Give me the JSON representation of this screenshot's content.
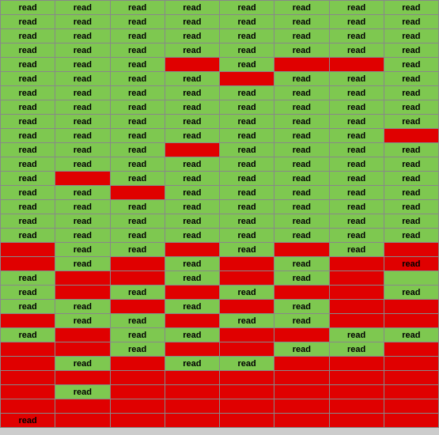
{
  "grid": {
    "rows": [
      [
        "green",
        "green",
        "green",
        "green",
        "green",
        "green",
        "green",
        "green"
      ],
      [
        "green",
        "green",
        "green",
        "green",
        "green",
        "green",
        "green",
        "green"
      ],
      [
        "green",
        "green",
        "green",
        "green",
        "green",
        "green",
        "green",
        "green"
      ],
      [
        "green",
        "green",
        "green",
        "green",
        "green",
        "green",
        "green",
        "green"
      ],
      [
        "green",
        "green",
        "green",
        "red",
        "green",
        "red",
        "red",
        "green"
      ],
      [
        "green",
        "green",
        "green",
        "green",
        "red",
        "green",
        "green",
        "green"
      ],
      [
        "green",
        "green",
        "green",
        "green",
        "green",
        "green",
        "green",
        "green"
      ],
      [
        "green",
        "green",
        "green",
        "green",
        "green",
        "green",
        "green",
        "green"
      ],
      [
        "green",
        "green",
        "green",
        "green",
        "green",
        "green",
        "green",
        "green"
      ],
      [
        "green",
        "green",
        "green",
        "green",
        "green",
        "green",
        "green",
        "red"
      ],
      [
        "green",
        "green",
        "green",
        "red",
        "green",
        "green",
        "green",
        "green"
      ],
      [
        "green",
        "green",
        "green",
        "green",
        "green",
        "green",
        "green",
        "green"
      ],
      [
        "green",
        "red",
        "green",
        "green",
        "green",
        "green",
        "green",
        "green"
      ],
      [
        "green",
        "green",
        "red",
        "green",
        "green",
        "green",
        "green",
        "green"
      ],
      [
        "green",
        "green",
        "green",
        "green",
        "green",
        "green",
        "green",
        "green"
      ],
      [
        "green",
        "green",
        "green",
        "green",
        "green",
        "green",
        "green",
        "green"
      ],
      [
        "green",
        "green",
        "green",
        "green",
        "green",
        "green",
        "green",
        "green"
      ],
      [
        "red",
        "green",
        "green",
        "red",
        "green",
        "red",
        "green",
        "red"
      ],
      [
        "red",
        "green",
        "red",
        "green",
        "red",
        "green",
        "red",
        "red"
      ],
      [
        "green",
        "red",
        "red",
        "green",
        "red",
        "green",
        "red",
        "green"
      ],
      [
        "green",
        "red",
        "green",
        "red",
        "green",
        "red",
        "red",
        "green"
      ],
      [
        "green",
        "green",
        "red",
        "green",
        "red",
        "green",
        "red",
        "red"
      ],
      [
        "red",
        "green",
        "green",
        "red",
        "green",
        "green",
        "red",
        "red"
      ],
      [
        "green",
        "red",
        "green",
        "green",
        "red",
        "red",
        "green",
        "green"
      ],
      [
        "red",
        "red",
        "green",
        "red",
        "red",
        "green",
        "green",
        "red"
      ],
      [
        "red",
        "green",
        "red",
        "green",
        "green",
        "red",
        "red",
        "red"
      ],
      [
        "red",
        "red",
        "red",
        "red",
        "red",
        "red",
        "red",
        "red"
      ],
      [
        "red",
        "green",
        "red",
        "red",
        "red",
        "red",
        "red",
        "red"
      ],
      [
        "red",
        "red",
        "red",
        "red",
        "red",
        "red",
        "red",
        "red"
      ],
      [
        "red",
        "red",
        "red",
        "red",
        "red",
        "red",
        "red",
        "red"
      ]
    ],
    "cells": [
      [
        "read",
        "read",
        "read",
        "read",
        "read",
        "read",
        "read",
        "read"
      ],
      [
        "read",
        "read",
        "read",
        "read",
        "read",
        "read",
        "read",
        "read"
      ],
      [
        "read",
        "read",
        "read",
        "read",
        "read",
        "read",
        "read",
        "read"
      ],
      [
        "read",
        "read",
        "read",
        "read",
        "read",
        "read",
        "read",
        "read"
      ],
      [
        "read",
        "read",
        "read",
        "",
        "read",
        "",
        "",
        "read"
      ],
      [
        "read",
        "read",
        "read",
        "read",
        "",
        "read",
        "read",
        "read"
      ],
      [
        "read",
        "read",
        "read",
        "read",
        "read",
        "read",
        "read",
        "read"
      ],
      [
        "read",
        "read",
        "read",
        "read",
        "read",
        "read",
        "read",
        "read"
      ],
      [
        "read",
        "read",
        "read",
        "read",
        "read",
        "read",
        "read",
        "read"
      ],
      [
        "read",
        "read",
        "read",
        "read",
        "read",
        "read",
        "read",
        ""
      ],
      [
        "read",
        "read",
        "read",
        "",
        "read",
        "read",
        "read",
        "read"
      ],
      [
        "read",
        "read",
        "read",
        "read",
        "read",
        "read",
        "read",
        "read"
      ],
      [
        "read",
        "",
        "read",
        "read",
        "read",
        "read",
        "read",
        "read"
      ],
      [
        "read",
        "read",
        "",
        "read",
        "read",
        "read",
        "read",
        "read"
      ],
      [
        "read",
        "read",
        "read",
        "read",
        "read",
        "read",
        "read",
        "read"
      ],
      [
        "read",
        "read",
        "read",
        "read",
        "read",
        "read",
        "read",
        "read"
      ],
      [
        "read",
        "read",
        "read",
        "read",
        "read",
        "read",
        "read",
        "read"
      ],
      [
        "",
        "read",
        "read",
        "",
        "read",
        "",
        "read",
        ""
      ],
      [
        "",
        "read",
        "",
        "read",
        "",
        "read",
        "",
        "read"
      ],
      [
        "read",
        "",
        "",
        "read",
        "",
        "read",
        "",
        ""
      ],
      [
        "read",
        "",
        "read",
        "",
        "read",
        "",
        "",
        "read"
      ],
      [
        "read",
        "read",
        "",
        "read",
        "",
        "read",
        "",
        ""
      ],
      [
        "",
        "read",
        "read",
        "",
        "read",
        "read",
        "",
        ""
      ],
      [
        "read",
        "",
        "read",
        "read",
        "",
        "",
        "read",
        "read"
      ],
      [
        "",
        "",
        "read",
        "",
        "",
        "read",
        "read",
        ""
      ],
      [
        "",
        "read",
        "",
        "read",
        "read",
        "",
        "",
        ""
      ],
      [
        "",
        "",
        "",
        "",
        "",
        "",
        "",
        ""
      ],
      [
        "",
        "read",
        "",
        "",
        "",
        "",
        "",
        ""
      ],
      [
        "",
        "",
        "",
        "",
        "",
        "",
        "",
        ""
      ],
      [
        "read",
        "",
        "",
        "",
        "",
        "",
        "",
        ""
      ]
    ]
  }
}
